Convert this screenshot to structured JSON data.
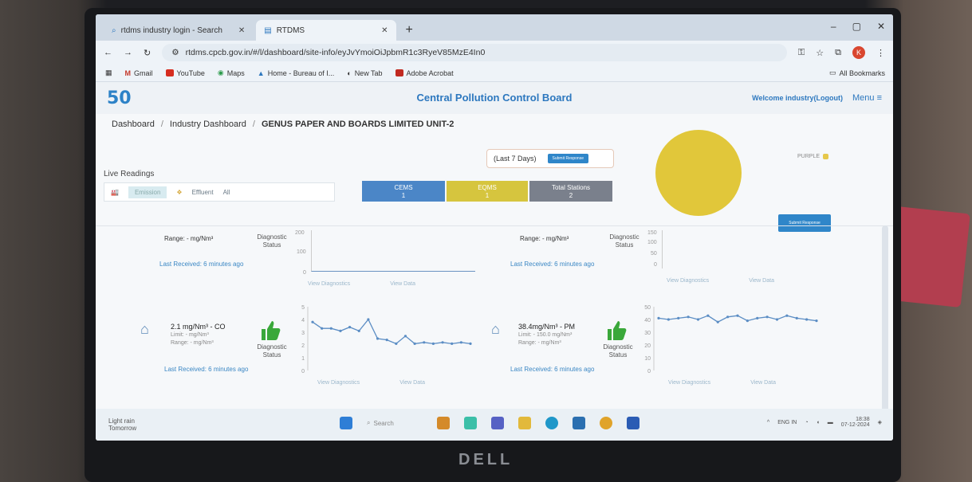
{
  "browser": {
    "tabs": [
      {
        "label": "rtdms industry login - Search"
      },
      {
        "label": "RTDMS"
      }
    ],
    "url": "rtdms.cpcb.gov.in/#/l/dashboard/site-info/eyJvYmoiOiJpbmR1c3RyeV85MzE4In0",
    "bookmarks": [
      "Gmail",
      "YouTube",
      "Maps",
      "Home - Bureau of I...",
      "New Tab",
      "Adobe Acrobat"
    ],
    "all_bookmarks": "All Bookmarks",
    "avatar_letter": "K"
  },
  "header": {
    "logo": "50",
    "title": "Central Pollution Control Board",
    "welcome": "Welcome industry(Logout)",
    "menu": "Menu ≡"
  },
  "breadcrumb": {
    "items": [
      "Dashboard",
      "Industry Dashboard",
      "GENUS PAPER AND BOARDS LIMITED UNIT-2"
    ]
  },
  "live_readings": {
    "title": "Live Readings",
    "filters": [
      "Emission",
      "Effluent",
      "All"
    ]
  },
  "stats": [
    {
      "label": "CEMS",
      "value": "1",
      "color": "#4b86c7"
    },
    {
      "label": "EQMS",
      "value": "1",
      "color": "#d6c53e"
    },
    {
      "label": "Total Stations",
      "value": "2",
      "color": "#7a808c"
    }
  ],
  "last7": {
    "label": "(Last 7 Days)",
    "button": "Submit Response"
  },
  "legend": {
    "label": "PURPLE"
  },
  "submit_response": "Submit Response",
  "cards_top": [
    {
      "range": "Range: - mg/Nm³",
      "diag": "Diagnostic Status",
      "last": "Last Received: 6 minutes ago",
      "y_ticks": [
        "200",
        "100",
        "0"
      ],
      "links": [
        "View Diagnostics",
        "View Data"
      ]
    },
    {
      "range": "Range: - mg/Nm³",
      "diag": "Diagnostic Status",
      "last": "Last Received: 6 minutes ago",
      "y_ticks": [
        "150",
        "100",
        "50",
        "0"
      ],
      "links": [
        "View Diagnostics",
        "View Data"
      ]
    }
  ],
  "cards": [
    {
      "value": "2.1 mg/Nm³ - CO",
      "limit": "Limit: - mg/Nm³",
      "range": "Range: - mg/Nm³",
      "diag": "Diagnostic Status",
      "last": "Last Received: 6 minutes ago",
      "y_ticks": [
        "5",
        "4",
        "3",
        "2",
        "1",
        "0"
      ],
      "links": [
        "View Diagnostics",
        "View Data"
      ]
    },
    {
      "value": "38.4mg/Nm³ - PM",
      "limit": "Limit: - 150.0 mg/Nm³",
      "range": "Range: - mg/Nm³",
      "diag": "Diagnostic Status",
      "last": "Last Received: 6 minutes ago",
      "y_ticks": [
        "50",
        "40",
        "30",
        "20",
        "10",
        "0"
      ],
      "links": [
        "View Diagnostics",
        "View Data"
      ]
    }
  ],
  "chart_data": [
    {
      "type": "line",
      "title": "",
      "ylim": [
        0,
        5
      ],
      "values": [
        3.8,
        3.3,
        3.3,
        3.1,
        3.4,
        3.1,
        4.0,
        2.5,
        2.4,
        2.1,
        2.7,
        2.1,
        2.2,
        2.1,
        2.2,
        2.1,
        2.2,
        2.1
      ]
    },
    {
      "type": "line",
      "title": "",
      "ylim": [
        0,
        50
      ],
      "values": [
        41,
        40,
        41,
        42,
        40,
        43,
        38,
        42,
        43,
        39,
        41,
        42,
        40,
        43,
        41,
        40,
        39
      ]
    }
  ],
  "taskbar": {
    "weather": "Light rain",
    "weather_sub": "Tomorrow",
    "search": "Search",
    "lang": "ENG IN",
    "time": "18:38",
    "date": "07-12-2024"
  }
}
